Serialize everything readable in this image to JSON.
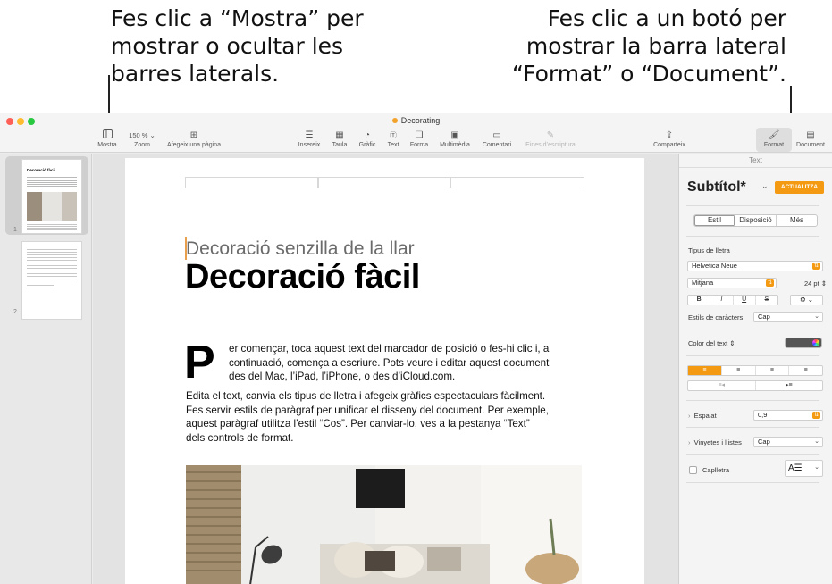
{
  "callouts": {
    "left": [
      "Fes clic a “Mostra” per",
      "mostrar o ocultar les",
      "barres laterals."
    ],
    "right": [
      "Fes clic a un botó per",
      "mostrar la barra lateral",
      "“Format” o “Document”."
    ]
  },
  "window": {
    "title": "Decorating",
    "title_dot_color": "#f3a32b"
  },
  "toolbar": {
    "view": {
      "label": "Mostra",
      "icon": "sidebar-icon"
    },
    "zoom": {
      "value": "150 %",
      "label": "Zoom"
    },
    "add_page": {
      "label": "Afegeix una pàgina",
      "icon": "plus-square-icon"
    },
    "insert": {
      "label": "Insereix",
      "icon": "insert-icon"
    },
    "table": {
      "label": "Taula",
      "icon": "table-icon"
    },
    "chart": {
      "label": "Gràfic",
      "icon": "chart-icon"
    },
    "text": {
      "label": "Text",
      "icon": "text-box-icon"
    },
    "shape": {
      "label": "Forma",
      "icon": "shape-icon"
    },
    "media": {
      "label": "Multimèdia",
      "icon": "media-icon"
    },
    "comment": {
      "label": "Comentari",
      "icon": "comment-icon"
    },
    "writing_tools": {
      "label": "Eines d’escriptura",
      "icon": "writing-tools-icon"
    },
    "share": {
      "label": "Comparteix",
      "icon": "share-icon"
    },
    "format": {
      "label": "Format",
      "icon": "paintbrush-icon"
    },
    "document": {
      "label": "Document",
      "icon": "document-icon"
    }
  },
  "sidebar": {
    "pages": [
      {
        "number": "1",
        "mini_title": "Decoració fàcil"
      },
      {
        "number": "2"
      }
    ]
  },
  "document": {
    "subtitle": "Decoració senzilla de la llar",
    "title": "Decoració fàcil",
    "drop_cap": "P",
    "para1_lines": [
      "er començar, toca aquest text del marcador de posició o fes-hi clic i, a",
      "continuació, comença a escriure. Pots veure i editar aquest document",
      "des del Mac, l’iPad, l’iPhone, o des d’iCloud.com."
    ],
    "para2_lines": [
      "Edita el text, canvia els tipus de lletra i afegeix gràfics espectaculars fàcilment.",
      "Fes servir estils de paràgraf per unificar el disseny del document. Per exemple,",
      "aquest paràgraf utilitza l’estil “Cos”. Per canviar-lo, ves a la pestanya “Text”",
      "dels controls de format."
    ]
  },
  "inspector": {
    "tab": "Text",
    "paragraph_style": "Subtítol*",
    "update_button": "ACTUALITZA",
    "segments": [
      "Estil",
      "Disposició",
      "Més"
    ],
    "selected_segment": "Estil",
    "font_section": "Tipus de lletra",
    "font_family": "Helvetica Neue",
    "font_typeface": "Mitjana",
    "font_size": "24 pt",
    "style_buttons": [
      "B",
      "I",
      "U",
      "S"
    ],
    "char_styles_label": "Estils de caràcters",
    "char_styles_value": "Cap",
    "text_color_label": "Color del text",
    "text_color": "#555555",
    "align_buttons": [
      "align-left-icon",
      "align-center-icon",
      "align-right-icon",
      "justify-icon"
    ],
    "selected_align": "align-left-icon",
    "spacing_label": "Espaiat",
    "spacing_value": "0,9",
    "bullets_label": "Vinyetes i llistes",
    "bullets_value": "Cap",
    "dropcap_label": "Caplletra",
    "accent": "#f39a12"
  }
}
